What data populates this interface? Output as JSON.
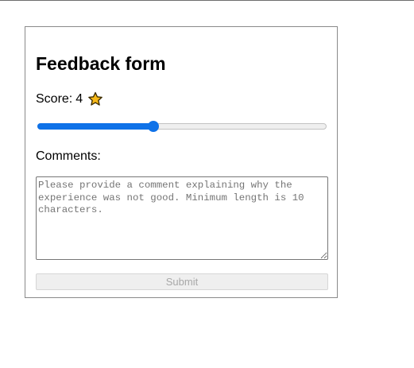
{
  "form": {
    "title": "Feedback form",
    "score_label": "Score:",
    "score_value": "4",
    "score_icon": "star-icon",
    "slider": {
      "value": 4,
      "min": 0,
      "max": 10,
      "fill_color": "#0f72e8"
    },
    "comments_label": "Comments:",
    "comments_value": "",
    "comments_placeholder": "Please provide a comment explaining why the experience was not good. Minimum length is 10 characters.",
    "submit_label": "Submit",
    "submit_disabled": true
  },
  "colors": {
    "accent": "#0f72e8",
    "star_fill": "#f7b918",
    "star_stroke": "#3a2a00"
  }
}
